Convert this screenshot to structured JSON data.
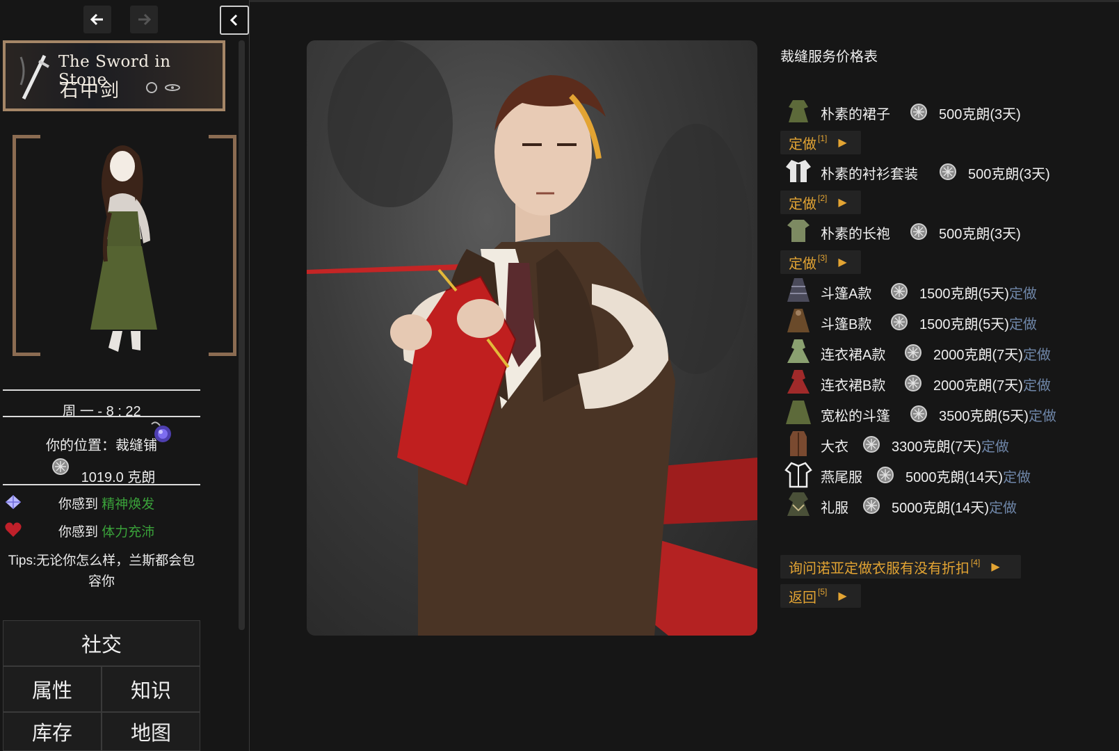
{
  "sidebar": {
    "banner": {
      "title_en": "The Sword in Stone",
      "title_zh": "石中剑"
    },
    "time": "周 一 - 8 : 22",
    "location": "你的位置：裁缝铺",
    "money": "1019.0 克朗",
    "moods": [
      {
        "label": "你感到 ",
        "value": "精神焕发",
        "icon": "crystal-icon"
      },
      {
        "label": "你感到 ",
        "value": "体力充沛",
        "icon": "heart-icon"
      }
    ],
    "tips": "Tips:无论你怎么样，兰斯都会包容你",
    "menu": {
      "social": "社交",
      "attributes": "属性",
      "knowledge": "知识",
      "inventory": "库存",
      "map": "地图"
    }
  },
  "main": {
    "title": "裁缝服务价格表",
    "items": [
      {
        "name": "朴素的裙子",
        "price": "500克朗(3天)",
        "order": ""
      },
      {
        "name": "朴素的衬衫套装",
        "price": "500克朗(3天)",
        "order": ""
      },
      {
        "name": "朴素的长袍",
        "price": "500克朗(3天)",
        "order": ""
      },
      {
        "name": "斗篷A款",
        "price": "1500克朗(5天)",
        "order": "定做"
      },
      {
        "name": "斗篷B款",
        "price": "1500克朗(5天)",
        "order": "定做"
      },
      {
        "name": "连衣裙A款",
        "price": "2000克朗(7天)",
        "order": "定做"
      },
      {
        "name": "连衣裙B款",
        "price": "2000克朗(7天)",
        "order": "定做"
      },
      {
        "name": "宽松的斗篷",
        "price": "3500克朗(5天)",
        "order": "定做"
      },
      {
        "name": "大衣",
        "price": "3300克朗(7天)",
        "order": "定做"
      },
      {
        "name": "燕尾服",
        "price": "5000克朗(14天)",
        "order": "定做"
      },
      {
        "name": "礼服",
        "price": "5000克朗(14天)",
        "order": "定做"
      }
    ],
    "order_buttons": [
      {
        "label": "定做",
        "key": "[1]"
      },
      {
        "label": "定做",
        "key": "[2]"
      },
      {
        "label": "定做",
        "key": "[3]"
      }
    ],
    "discount_button": {
      "label": "询问诺亚定做衣服有没有折扣",
      "key": "[4]"
    },
    "back_button": {
      "label": "返回",
      "key": "[5]"
    }
  },
  "colors": {
    "accent": "#e3a433",
    "positive": "#3aa23a",
    "link": "#6f86a8",
    "frame": "#a58667"
  }
}
